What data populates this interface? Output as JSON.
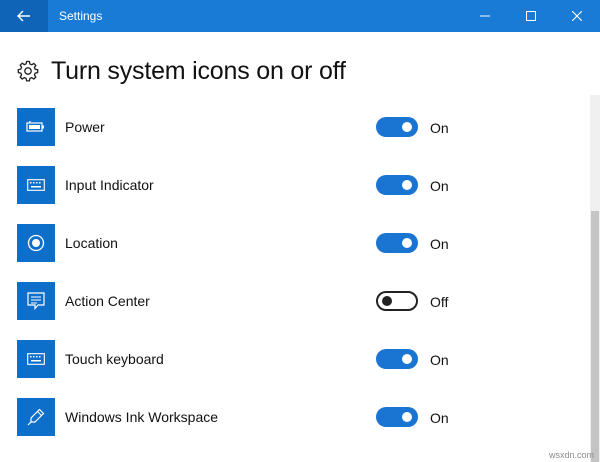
{
  "window": {
    "title": "Settings",
    "accent": "#1a7bd6"
  },
  "header": {
    "title": "Turn system icons on or off",
    "icon": "gear-icon"
  },
  "items": [
    {
      "label": "Power",
      "state": "On",
      "on": true,
      "icon": "battery-icon"
    },
    {
      "label": "Input Indicator",
      "state": "On",
      "on": true,
      "icon": "keyboard-icon"
    },
    {
      "label": "Location",
      "state": "On",
      "on": true,
      "icon": "location-icon"
    },
    {
      "label": "Action Center",
      "state": "Off",
      "on": false,
      "icon": "action-center-icon"
    },
    {
      "label": "Touch keyboard",
      "state": "On",
      "on": true,
      "icon": "keyboard-icon"
    },
    {
      "label": "Windows Ink Workspace",
      "state": "On",
      "on": true,
      "icon": "pen-icon"
    }
  ],
  "watermark": "wsxdn.com"
}
